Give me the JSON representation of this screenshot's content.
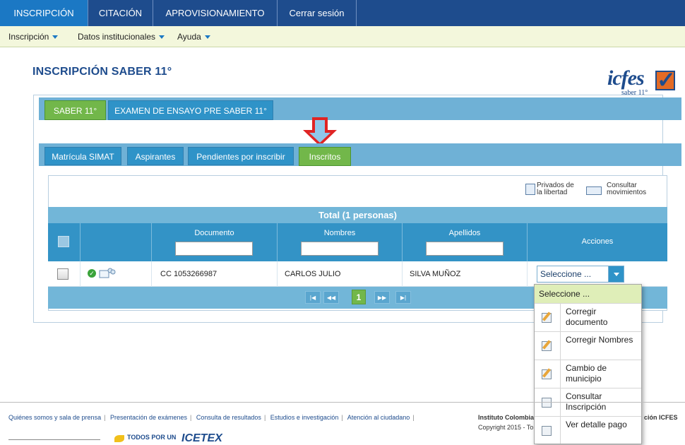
{
  "topnav": {
    "tabs": [
      "INSCRIPCIÓN",
      "CITACIÓN",
      "APROVISIONAMIENTO",
      "Cerrar sesión"
    ]
  },
  "subnav": {
    "items": [
      "Inscripción",
      "Datos institucionales",
      "Ayuda"
    ]
  },
  "page": {
    "title": "INSCRIPCIÓN SABER 11°"
  },
  "logo": {
    "word": "icfes",
    "sub": "saber 11°"
  },
  "exam_tabs": [
    "SABER 11°",
    "EXAMEN DE ENSAYO PRE SABER 11°"
  ],
  "sub_tabs": [
    "Matrícula SIMAT",
    "Aspirantes",
    "Pendientes por inscribir",
    "Inscritos"
  ],
  "actions": {
    "privados": "Privados de la libertad",
    "consultar": "Consultar movimientos"
  },
  "table": {
    "total": "Total (1 personas)",
    "headers": [
      "Documento",
      "Nombres",
      "Apellidos",
      "Acciones"
    ],
    "rows": [
      {
        "documento": "CC 1053266987",
        "nombres": "CARLOS JULIO",
        "apellidos": "SILVA MUÑOZ",
        "accion": "Seleccione ..."
      }
    ]
  },
  "pager": {
    "first": "|◀",
    "prev": "◀◀",
    "page": "1",
    "next": "▶▶",
    "last": "▶|"
  },
  "dropdown": {
    "header": "Seleccione ...",
    "items": [
      {
        "label": "Corregir documento",
        "icon": "edit-document-icon"
      },
      {
        "label": "Corregir Nombres",
        "icon": "edit-names-icon"
      },
      {
        "label": "Cambio de municipio",
        "icon": "change-municipality-icon"
      },
      {
        "label": "Consultar Inscripción",
        "icon": "view-registration-icon"
      },
      {
        "label": "Ver detalle pago",
        "icon": "payment-detail-icon"
      }
    ]
  },
  "footer": {
    "links": [
      "Quiénes somos y sala de prensa",
      "Presentación de exámenes",
      "Consulta de resultados",
      "Estudios e investigación",
      "Atención al ciudadano"
    ],
    "institute": "Instituto Colombia",
    "copyright": "Copyright 2015 - To",
    "right": "ción ICFES",
    "logo_text_1": "TODOS POR UN",
    "logo_text_2": "ICETEX"
  },
  "colors": {
    "nav_blue": "#1e4c8d",
    "tab_blue": "#2f93c8",
    "tab_green": "#72b74a",
    "arrow_red": "#e02424"
  }
}
